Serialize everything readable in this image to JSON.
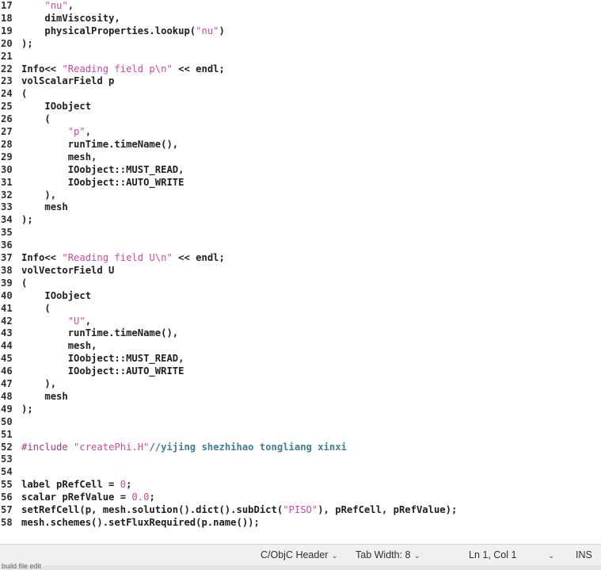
{
  "editor": {
    "lines": [
      {
        "n": "17",
        "t": [
          [
            "s",
            "\"nu\""
          ],
          [
            "t",
            ","
          ]
        ],
        "i": "    "
      },
      {
        "n": "18",
        "t": [
          [
            "t",
            "dimViscosity,"
          ]
        ],
        "i": "    "
      },
      {
        "n": "19",
        "t": [
          [
            "t",
            "physicalProperties.lookup("
          ],
          [
            "s",
            "\"nu\""
          ],
          [
            "t",
            ")"
          ]
        ],
        "i": "    "
      },
      {
        "n": "20",
        "t": [
          [
            "t",
            ");"
          ]
        ],
        "i": ""
      },
      {
        "n": "21",
        "t": [],
        "i": ""
      },
      {
        "n": "22",
        "t": [
          [
            "t",
            "Info<< "
          ],
          [
            "s",
            "\"Reading field p\\n\""
          ],
          [
            "t",
            " << endl;"
          ]
        ],
        "i": ""
      },
      {
        "n": "23",
        "t": [
          [
            "t",
            "volScalarField p"
          ]
        ],
        "i": ""
      },
      {
        "n": "24",
        "t": [
          [
            "t",
            "("
          ]
        ],
        "i": ""
      },
      {
        "n": "25",
        "t": [
          [
            "t",
            "IOobject"
          ]
        ],
        "i": "    "
      },
      {
        "n": "26",
        "t": [
          [
            "t",
            "("
          ]
        ],
        "i": "    "
      },
      {
        "n": "27",
        "t": [
          [
            "s",
            "\"p\""
          ],
          [
            "t",
            ","
          ]
        ],
        "i": "        "
      },
      {
        "n": "28",
        "t": [
          [
            "t",
            "runTime.timeName(),"
          ]
        ],
        "i": "        "
      },
      {
        "n": "29",
        "t": [
          [
            "t",
            "mesh,"
          ]
        ],
        "i": "        "
      },
      {
        "n": "30",
        "t": [
          [
            "t",
            "IOobject::MUST_READ,"
          ]
        ],
        "i": "        "
      },
      {
        "n": "31",
        "t": [
          [
            "t",
            "IOobject::AUTO_WRITE"
          ]
        ],
        "i": "        "
      },
      {
        "n": "32",
        "t": [
          [
            "t",
            "),"
          ]
        ],
        "i": "    "
      },
      {
        "n": "33",
        "t": [
          [
            "t",
            "mesh"
          ]
        ],
        "i": "    "
      },
      {
        "n": "34",
        "t": [
          [
            "t",
            ");"
          ]
        ],
        "i": ""
      },
      {
        "n": "35",
        "t": [],
        "i": ""
      },
      {
        "n": "36",
        "t": [],
        "i": ""
      },
      {
        "n": "37",
        "t": [
          [
            "t",
            "Info<< "
          ],
          [
            "s",
            "\"Reading field U\\n\""
          ],
          [
            "t",
            " << endl;"
          ]
        ],
        "i": ""
      },
      {
        "n": "38",
        "t": [
          [
            "t",
            "volVectorField U"
          ]
        ],
        "i": ""
      },
      {
        "n": "39",
        "t": [
          [
            "t",
            "("
          ]
        ],
        "i": ""
      },
      {
        "n": "40",
        "t": [
          [
            "t",
            "IOobject"
          ]
        ],
        "i": "    "
      },
      {
        "n": "41",
        "t": [
          [
            "t",
            "("
          ]
        ],
        "i": "    "
      },
      {
        "n": "42",
        "t": [
          [
            "s",
            "\"U\""
          ],
          [
            "t",
            ","
          ]
        ],
        "i": "        "
      },
      {
        "n": "43",
        "t": [
          [
            "t",
            "runTime.timeName(),"
          ]
        ],
        "i": "        "
      },
      {
        "n": "44",
        "t": [
          [
            "t",
            "mesh,"
          ]
        ],
        "i": "        "
      },
      {
        "n": "45",
        "t": [
          [
            "t",
            "IOobject::MUST_READ,"
          ]
        ],
        "i": "        "
      },
      {
        "n": "46",
        "t": [
          [
            "t",
            "IOobject::AUTO_WRITE"
          ]
        ],
        "i": "        "
      },
      {
        "n": "47",
        "t": [
          [
            "t",
            "),"
          ]
        ],
        "i": "    "
      },
      {
        "n": "48",
        "t": [
          [
            "t",
            "mesh"
          ]
        ],
        "i": "    "
      },
      {
        "n": "49",
        "t": [
          [
            "t",
            ");"
          ]
        ],
        "i": ""
      },
      {
        "n": "50",
        "t": [],
        "i": ""
      },
      {
        "n": "51",
        "t": [],
        "i": ""
      },
      {
        "n": "52",
        "t": [
          [
            "p",
            "#include "
          ],
          [
            "s",
            "\"createPhi.H\""
          ],
          [
            "c",
            "//yijing shezhihao tongliang xinxi"
          ]
        ],
        "i": ""
      },
      {
        "n": "53",
        "t": [],
        "i": ""
      },
      {
        "n": "54",
        "t": [],
        "i": ""
      },
      {
        "n": "55",
        "t": [
          [
            "t",
            "label pRefCell = "
          ],
          [
            "n",
            "0"
          ],
          [
            "t",
            ";"
          ]
        ],
        "i": ""
      },
      {
        "n": "56",
        "t": [
          [
            "t",
            "scalar pRefValue = "
          ],
          [
            "n",
            "0.0"
          ],
          [
            "t",
            ";"
          ]
        ],
        "i": ""
      },
      {
        "n": "57",
        "t": [
          [
            "t",
            "setRefCell(p, mesh.solution().dict().subDict("
          ],
          [
            "s",
            "\"PISO\""
          ],
          [
            "t",
            "), pRefCell, pRefValue);"
          ]
        ],
        "i": ""
      },
      {
        "n": "58",
        "t": [
          [
            "t",
            "mesh.schemes().setFluxRequired(p.name());"
          ]
        ],
        "i": ""
      }
    ]
  },
  "statusbar": {
    "language": "C/ObjC Header",
    "tab_width": "Tab Width: 8",
    "cursor": "Ln 1, Col 1",
    "mode": "INS"
  },
  "bottom": {
    "label": "build file edit"
  }
}
